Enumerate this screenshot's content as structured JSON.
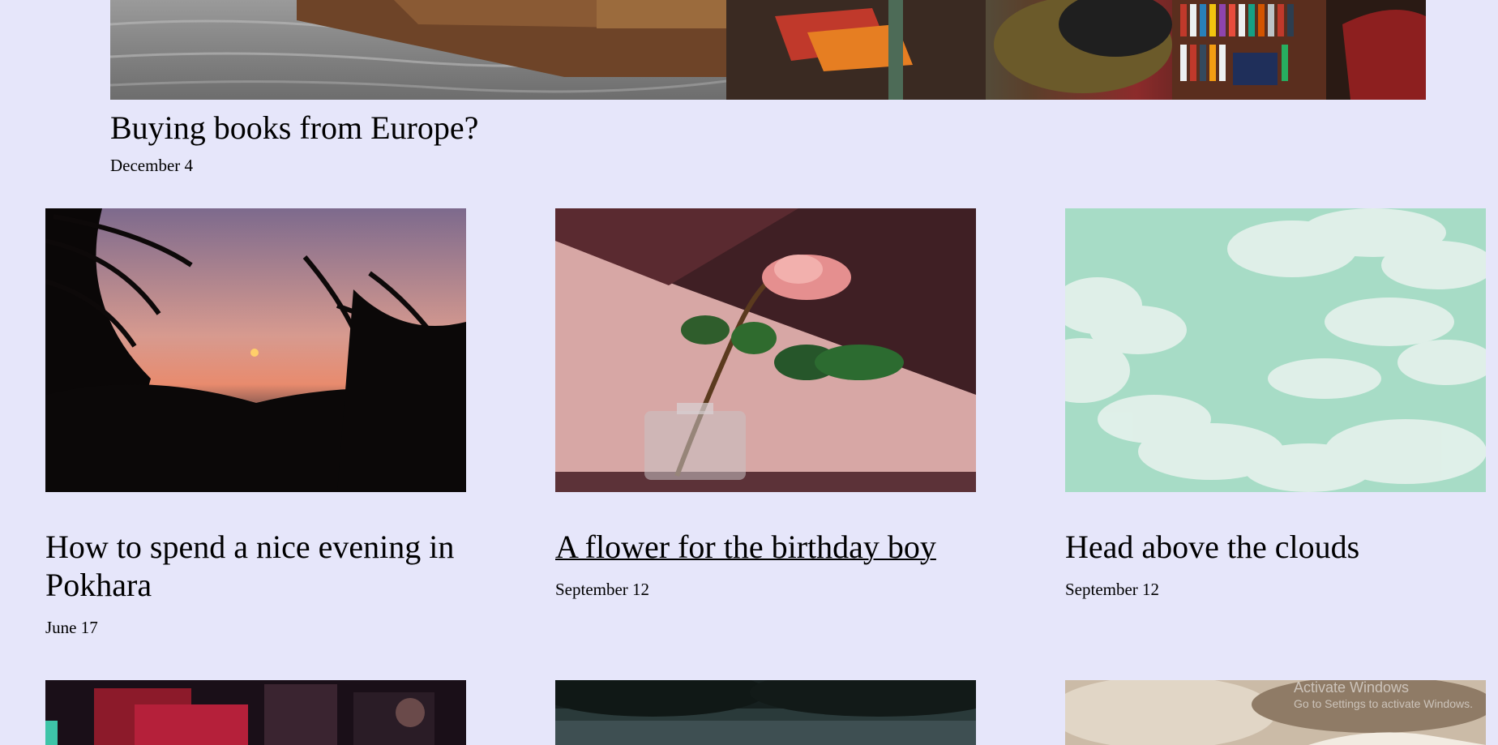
{
  "featured": {
    "title": "Buying books from Europe?",
    "date": "December 4"
  },
  "posts": [
    {
      "title": "How to spend a nice evening in Pokhara",
      "date": "June 17"
    },
    {
      "title": "A flower for the birthday boy",
      "date": "September 12"
    },
    {
      "title": "Head above the clouds",
      "date": "September 12"
    }
  ],
  "watermark": {
    "line1": "Activate Windows",
    "line2": "Go to Settings to activate Windows."
  },
  "colors": {
    "background": "#e6e6fa",
    "text": "#000000"
  }
}
